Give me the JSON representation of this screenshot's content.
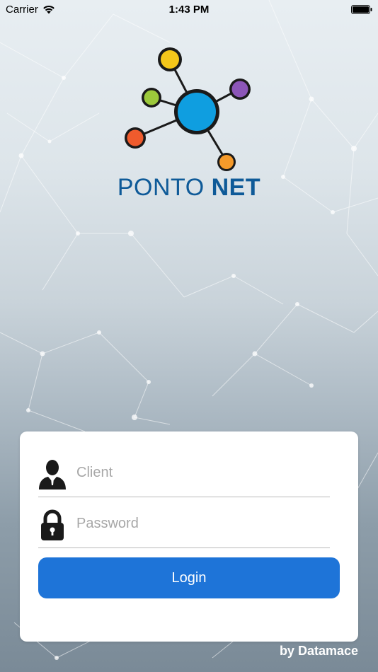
{
  "status_bar": {
    "carrier": "Carrier",
    "time": "1:43 PM",
    "wifi_icon": "wifi-icon",
    "battery_icon": "battery-icon"
  },
  "logo": {
    "brand_light": "PONTO ",
    "brand_bold": "NET",
    "colors": {
      "center": "#0f9ee0",
      "yellow": "#f5c71a",
      "green": "#9cc93b",
      "orange_red": "#ef5b2d",
      "purple": "#8c56b8",
      "orange": "#f59a2a",
      "brand_text": "#0e5a98"
    }
  },
  "login_form": {
    "client": {
      "icon": "user-icon",
      "placeholder": "Client",
      "value": ""
    },
    "password": {
      "icon": "lock-icon",
      "placeholder": "Password",
      "value": ""
    },
    "login_button": {
      "label": "Login",
      "color": "#1e74d8"
    }
  },
  "footer": {
    "text": "by Datamace"
  }
}
